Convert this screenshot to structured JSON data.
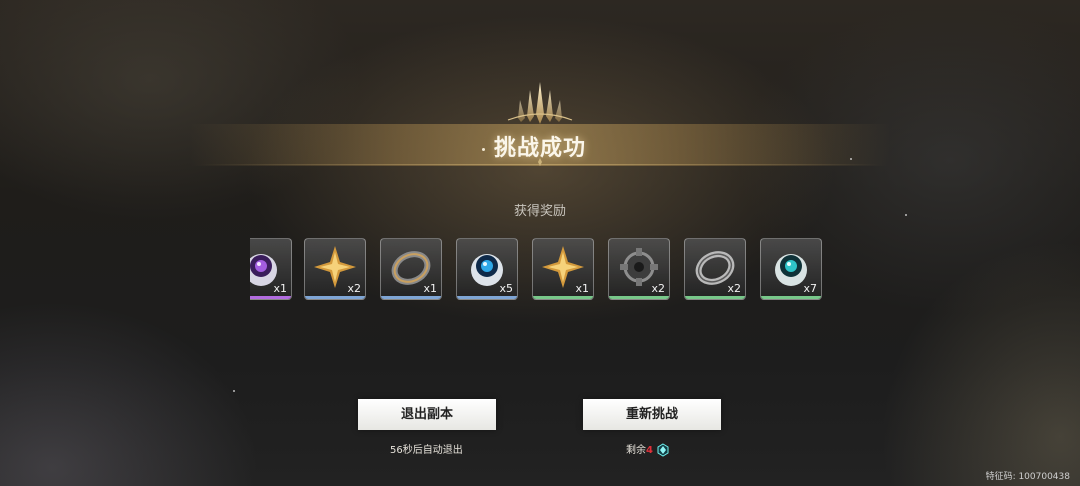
{
  "header": {
    "title": "挑战成功"
  },
  "rewards": {
    "label": "获得奖励",
    "items": [
      {
        "icon": "purple-orb-icon",
        "qty": "x1",
        "rarity_color": "#b26ce0"
      },
      {
        "icon": "gold-star-shard-icon",
        "qty": "x2",
        "rarity_color": "#7fa6d6"
      },
      {
        "icon": "bronze-ring-icon",
        "qty": "x1",
        "rarity_color": "#7fa6d6"
      },
      {
        "icon": "blue-orb-icon",
        "qty": "x5",
        "rarity_color": "#7fa6d6"
      },
      {
        "icon": "gold-star-shard-icon",
        "qty": "x1",
        "rarity_color": "#78c88a"
      },
      {
        "icon": "metal-cog-icon",
        "qty": "x2",
        "rarity_color": "#78c88a"
      },
      {
        "icon": "silver-ring-icon",
        "qty": "x2",
        "rarity_color": "#78c88a"
      },
      {
        "icon": "teal-orb-icon",
        "qty": "x7",
        "rarity_color": "#78c88a"
      }
    ]
  },
  "actions": {
    "exit_label": "退出副本",
    "exit_note": "56秒后自动退出",
    "retry_label": "重新挑战",
    "retry_note_prefix": "剩余",
    "retry_count": "4",
    "retry_cost_icon": "cyan-crystal-icon"
  },
  "footer": {
    "feature_code": "特征码: 100700438"
  }
}
